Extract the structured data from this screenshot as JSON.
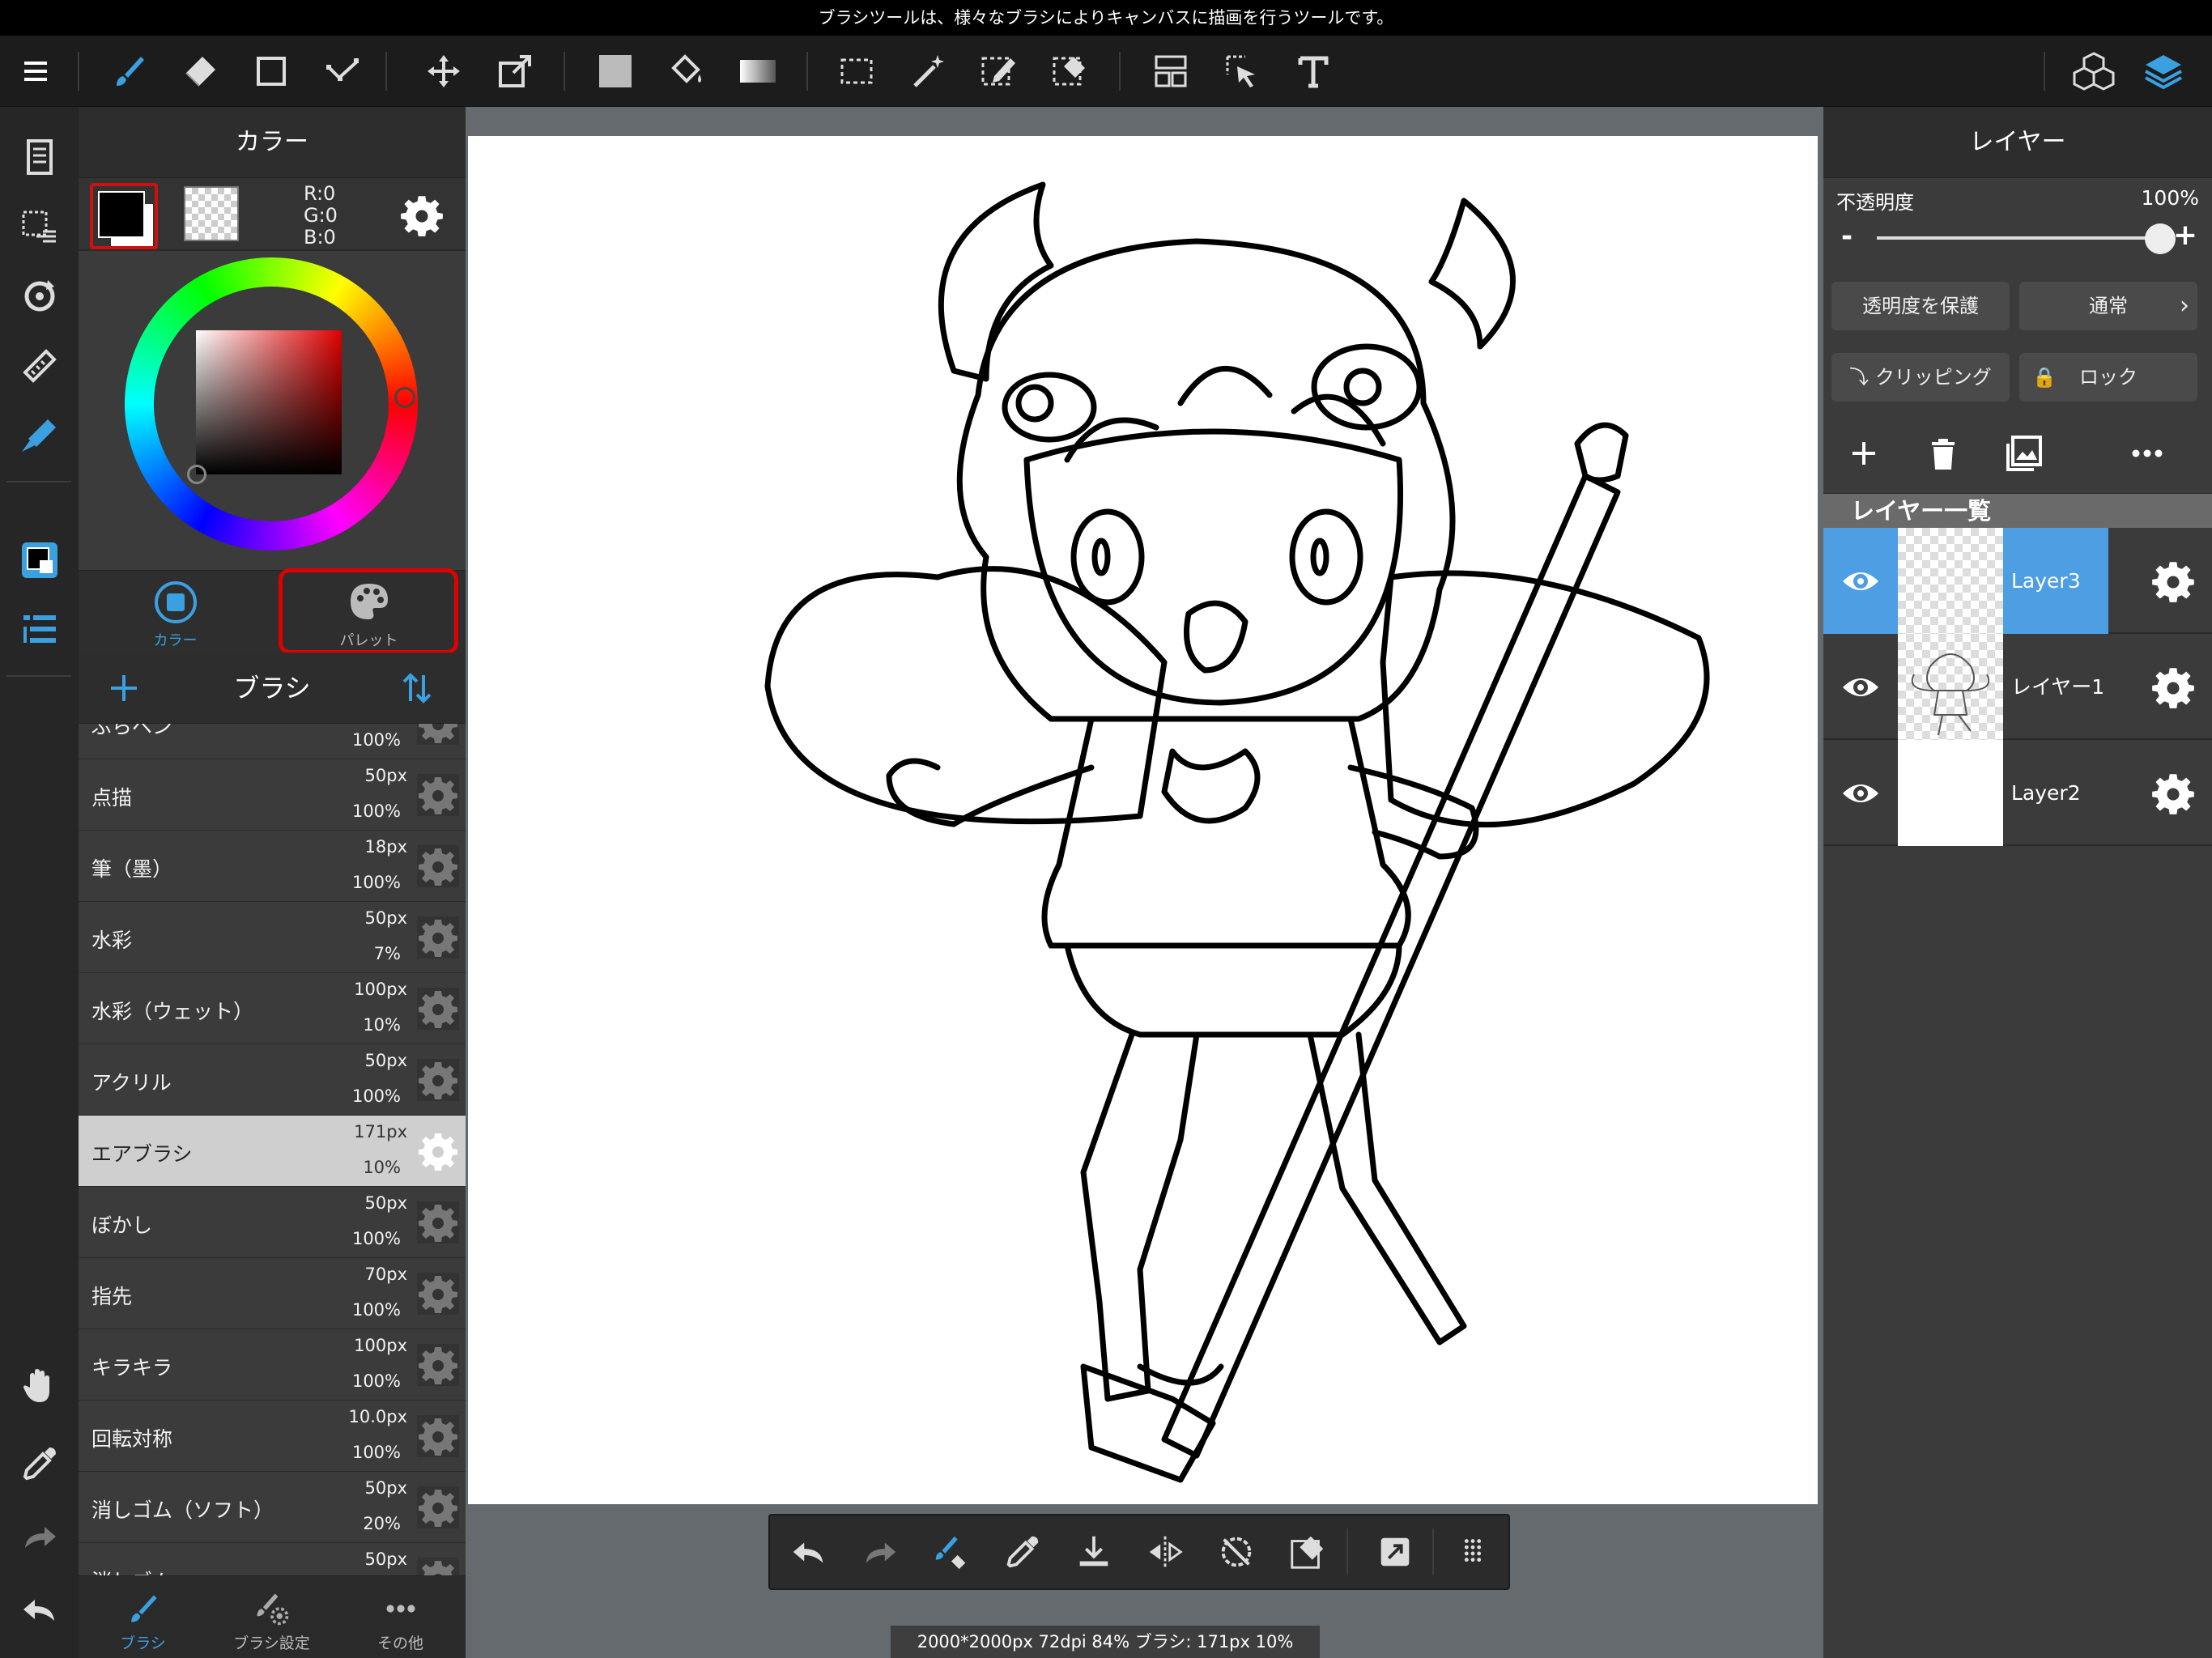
{
  "status_message": "ブラシツールは、様々なブラシによりキャンバスに描画を行うツールです。",
  "toolbar": {
    "icons": [
      "menu-icon",
      "brush-icon",
      "eraser-icon",
      "rectangle-icon",
      "pen-node-icon",
      "move-icon",
      "transform-icon",
      "fill-color-icon",
      "bucket-icon",
      "gradient-icon",
      "select-rect-icon",
      "magic-wand-icon",
      "select-pen-icon",
      "select-eraser-icon",
      "layout-icon",
      "select-move-icon",
      "text-icon",
      "material-icon",
      "layer-icon"
    ]
  },
  "color_panel": {
    "title": "カラー",
    "rgb": {
      "r": "R:0",
      "g": "G:0",
      "b": "B:0"
    },
    "foreground": "#000000",
    "tabs": [
      {
        "label": "カラー",
        "active": true
      },
      {
        "label": "パレット",
        "active": false
      }
    ]
  },
  "brush_panel": {
    "title": "ブラシ",
    "brushes": [
      {
        "name": "ぶらペン",
        "size": "",
        "opacity": "100%"
      },
      {
        "name": "点描",
        "size": "50px",
        "opacity": "100%"
      },
      {
        "name": "筆（墨）",
        "size": "18px",
        "opacity": "100%"
      },
      {
        "name": "水彩",
        "size": "50px",
        "opacity": "7%"
      },
      {
        "name": "水彩（ウェット）",
        "size": "100px",
        "opacity": "10%"
      },
      {
        "name": "アクリル",
        "size": "50px",
        "opacity": "100%"
      },
      {
        "name": "エアブラシ",
        "size": "171px",
        "opacity": "10%",
        "selected": true
      },
      {
        "name": "ぼかし",
        "size": "50px",
        "opacity": "100%"
      },
      {
        "name": "指先",
        "size": "70px",
        "opacity": "100%"
      },
      {
        "name": "キラキラ",
        "size": "100px",
        "opacity": "100%"
      },
      {
        "name": "回転対称",
        "size": "10.0px",
        "opacity": "100%"
      },
      {
        "name": "消しゴム（ソフト）",
        "size": "50px",
        "opacity": "20%"
      },
      {
        "name": "消しゴム",
        "size": "50px",
        "opacity": ""
      }
    ]
  },
  "bottom_tabs": [
    {
      "label": "ブラシ",
      "active": true
    },
    {
      "label": "ブラシ設定",
      "active": false
    },
    {
      "label": "その他",
      "active": false
    }
  ],
  "canvas_info": "2000*2000px 72dpi 84% ブラシ: 171px 10%",
  "layer_panel": {
    "title": "レイヤー",
    "opacity_label": "不透明度",
    "opacity_value": "100%",
    "opacity_fraction": 1.0,
    "minus": "-",
    "plus": "+",
    "protect_alpha": "透明度を保護",
    "blend_mode": "通常",
    "clipping": "クリッピング",
    "lock": "ロック",
    "list_header": "レイヤー一覧",
    "layers": [
      {
        "name": "Layer3",
        "selected": true
      },
      {
        "name": "レイヤー1",
        "selected": false
      },
      {
        "name": "Layer2",
        "selected": false
      }
    ]
  }
}
